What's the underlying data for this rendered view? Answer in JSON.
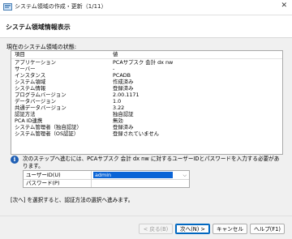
{
  "window": {
    "title": "システム領域の作成・更新（1/11）",
    "close_glyph": "✕"
  },
  "header": {
    "heading": "システム領域情報表示"
  },
  "status_section": {
    "label": "現在のシステム領域の状態:",
    "columns": [
      "項目",
      "値"
    ],
    "rows": [
      [
        "アプリケーション",
        "PCAサプスク 会計 dx nw"
      ],
      [
        "サーバー",
        "-"
      ],
      [
        "インスタンス",
        "PCADB"
      ],
      [
        "システム領域",
        "作成済み"
      ],
      [
        "システム情報",
        "登録済み"
      ],
      [
        "プログラムバージョン",
        "2.00.1171"
      ],
      [
        "データバージョン",
        "1.0"
      ],
      [
        "共通データバージョン",
        "3.22"
      ],
      [
        "認証方法",
        "独自認証"
      ],
      [
        "PCA ID連携",
        "無効"
      ],
      [
        "システム管理者（独自認証）",
        "登録済み"
      ],
      [
        "システム管理者（OS認証）",
        "登録されていません"
      ]
    ]
  },
  "info": {
    "text": "次のステップへ進むには、PCAサプスク 会計 dx nw に対するユーザーIDとパスワードを入力する必要があります。"
  },
  "form": {
    "user_label": "ユーザーID(U)",
    "user_value": "admin",
    "password_label": "パスワード(P)",
    "password_value": ""
  },
  "footer": {
    "text": "[次へ] を選択すると、認証方法の選択へ進みます。"
  },
  "buttons": {
    "back": "< 戻る(B)",
    "next": "次へ(N) >",
    "cancel": "キャンセル",
    "help": "ヘルプ(F1)"
  }
}
